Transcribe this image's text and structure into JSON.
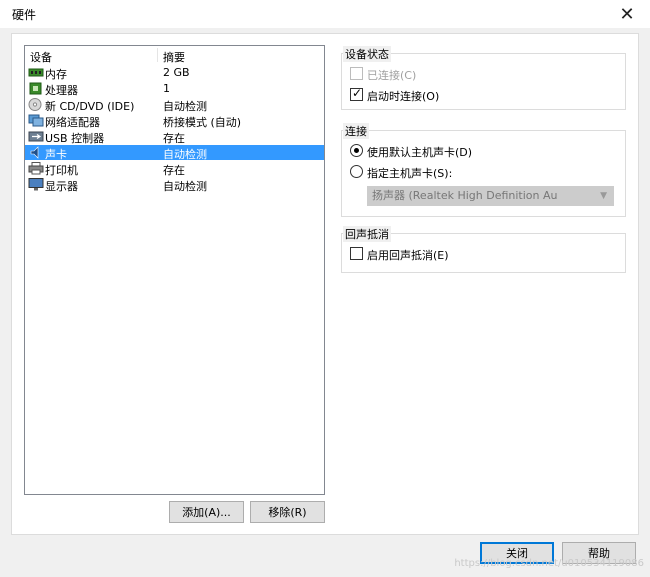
{
  "window": {
    "title": "硬件",
    "close_glyph": "✕"
  },
  "device_list": {
    "header": {
      "device": "设备",
      "summary": "摘要"
    },
    "rows": [
      {
        "name": "内存",
        "summary": "2 GB",
        "icon": "memory-icon",
        "selected": false
      },
      {
        "name": "处理器",
        "summary": "1",
        "icon": "processor-icon",
        "selected": false
      },
      {
        "name": "新 CD/DVD (IDE)",
        "summary": "自动检测",
        "icon": "cd-dvd-icon",
        "selected": false
      },
      {
        "name": "网络适配器",
        "summary": "桥接模式 (自动)",
        "icon": "network-adapter-icon",
        "selected": false
      },
      {
        "name": "USB 控制器",
        "summary": "存在",
        "icon": "usb-icon",
        "selected": false
      },
      {
        "name": "声卡",
        "summary": "自动检测",
        "icon": "sound-card-icon",
        "selected": true
      },
      {
        "name": "打印机",
        "summary": "存在",
        "icon": "printer-icon",
        "selected": false
      },
      {
        "name": "显示器",
        "summary": "自动检测",
        "icon": "display-icon",
        "selected": false
      }
    ],
    "add_label": "添加(A)...",
    "remove_label": "移除(R)"
  },
  "device_status": {
    "title": "设备状态",
    "connected_label": "已连接(C)",
    "connected_checked": false,
    "connected_enabled": false,
    "connect_on_start_label": "启动时连接(O)",
    "connect_on_start_checked": true
  },
  "connection": {
    "title": "连接",
    "use_default_label": "使用默认主机声卡(D)",
    "use_default_selected": true,
    "specify_label": "指定主机声卡(S):",
    "specify_selected": false,
    "host_card_value": "扬声器 (Realtek High Definition Au"
  },
  "echo_cancel": {
    "title": "回声抵消",
    "enable_label": "启用回声抵消(E)",
    "enable_checked": false
  },
  "footer": {
    "close_label": "关闭",
    "help_label": "帮助"
  },
  "watermark": "https://blog.csdn.net/u010534119086",
  "colors": {
    "selection": "#3399ff",
    "accent": "#0078d7"
  }
}
